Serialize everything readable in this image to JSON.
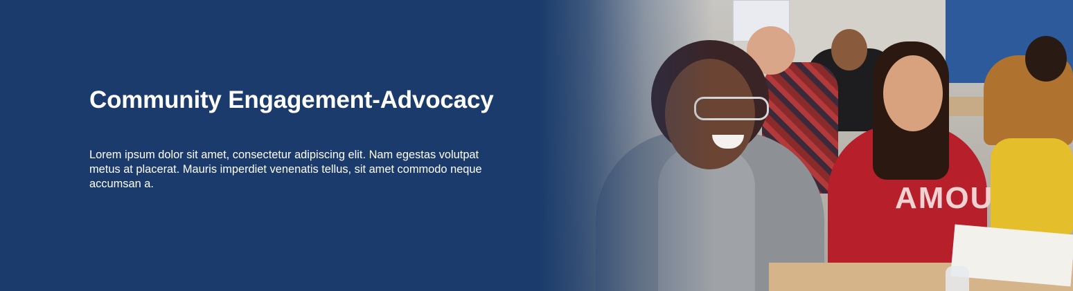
{
  "hero": {
    "title": "Community Engagement-Advocacy",
    "description": "Lorem ipsum dolor sit amet, consectetur adipiscing elit. Nam egestas volutpat metus at placerat. Mauris imperdiet venenatis tellus, sit amet commodo neque accumsan a.",
    "shirt_text": "AMOUR",
    "background_color": "#1a3b6b",
    "text_color": "#ffffff"
  }
}
